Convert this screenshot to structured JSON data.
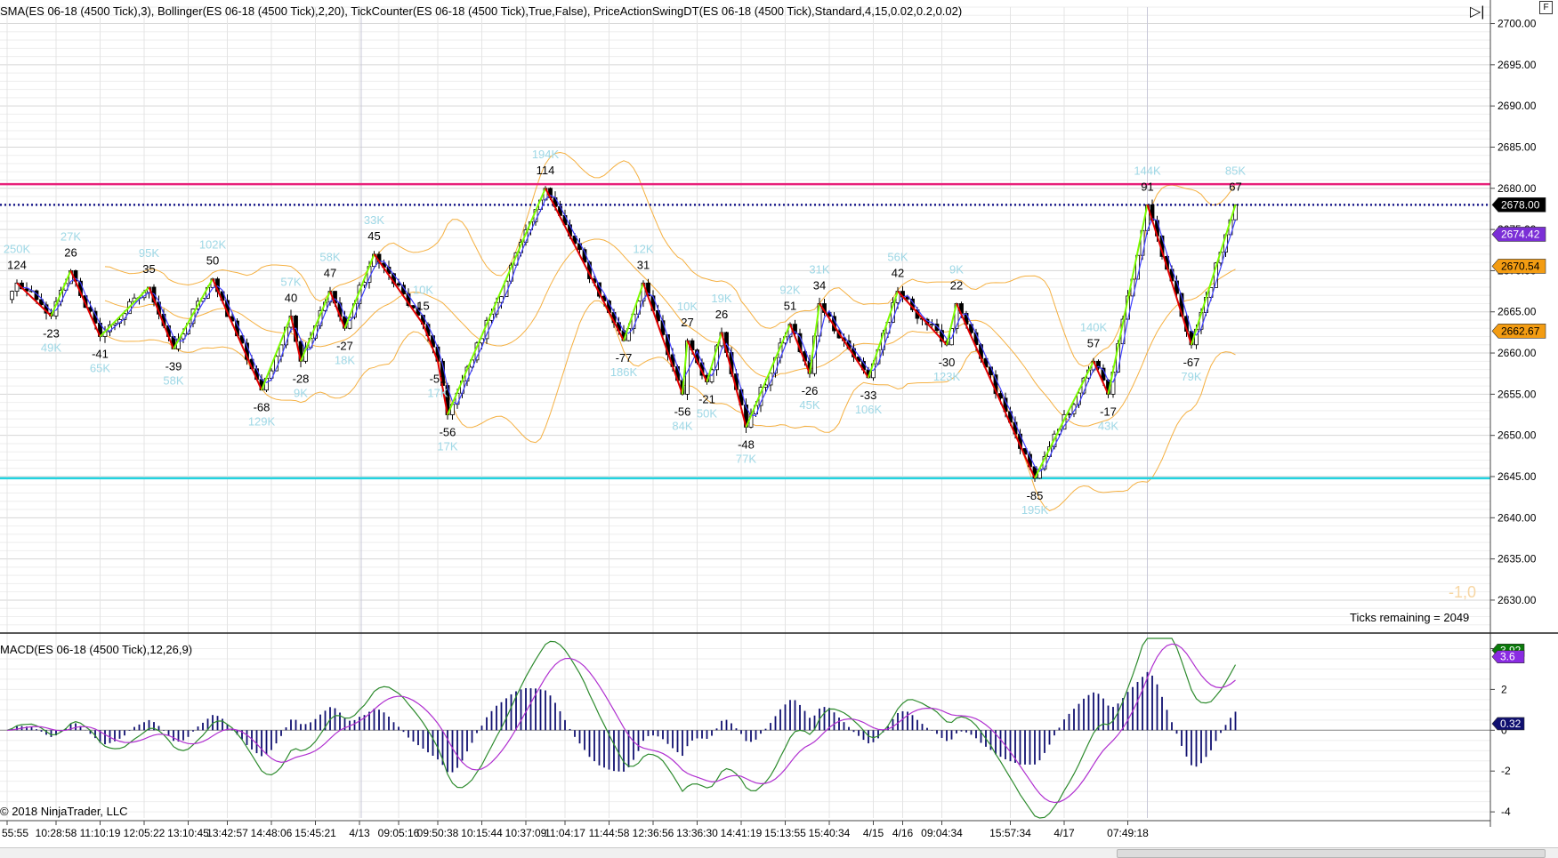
{
  "window": {
    "corner_button": "F"
  },
  "price_panel": {
    "indicator_label": "SMA(ES  06-18  (4500  Tick),3),   Bollinger(ES  06-18  (4500  Tick),2,20),   TickCounter(ES  06-18  (4500  Tick),True,False),   PriceActionSwingDT(ES  06-18  (4500  Tick),Standard,4,15,0.02,0.2,0.02)",
    "ticks_remaining": "Ticks remaining = 2049",
    "faint_value": "-1,0"
  },
  "macd_panel": {
    "indicator_label": "MACD(ES 06-18 (4500 Tick),12,26,9)",
    "copyright": "© 2018 NinjaTrader, LLC"
  },
  "chart_data": {
    "type": "candlestick",
    "price_axis": {
      "ylim": [
        2626,
        2702
      ],
      "ticks": [
        "2700.00",
        "2695.00",
        "2690.00",
        "2685.00",
        "2680.00",
        "2675.00",
        "2670.00",
        "2665.00",
        "2660.00",
        "2655.00",
        "2650.00",
        "2645.00",
        "2640.00",
        "2635.00",
        "2630.00"
      ],
      "tick_values": [
        2700,
        2695,
        2690,
        2685,
        2680,
        2675,
        2670,
        2665,
        2660,
        2655,
        2650,
        2645,
        2640,
        2635,
        2630
      ]
    },
    "macd_axis": {
      "ylim": [
        -4.3,
        4.5
      ],
      "ticks": [
        "4",
        "2",
        "0",
        "-2",
        "-4"
      ],
      "tick_values": [
        4,
        2,
        0,
        -2,
        -4
      ]
    },
    "time_axis": {
      "bars": 241,
      "labels": [
        "55:55",
        "10:28:58",
        "11:10:19",
        "12:05:22",
        "13:10:45",
        "13:42:57",
        "14:48:06",
        "15:45:21",
        "4/13",
        "09:05:16",
        "09:50:38",
        "10:15:44",
        "10:37:09",
        "11:04:17",
        "11:44:58",
        "12:36:56",
        "13:36:30",
        "14:41:19",
        "15:13:55",
        "15:40:34",
        "4/15",
        "4/16",
        "09:04:34",
        "15:57:34",
        "4/17",
        "07:49:18"
      ],
      "label_bars": [
        0,
        10,
        19,
        28,
        37,
        45,
        54,
        63,
        72,
        80,
        88,
        97,
        106,
        114,
        123,
        132,
        141,
        150,
        159,
        168,
        177,
        183,
        191,
        205,
        216,
        229
      ]
    },
    "horizontal_lines": [
      {
        "name": "resistance",
        "value": 2680.5,
        "color": "#e8217a",
        "style": "solid"
      },
      {
        "name": "current",
        "value": 2678.0,
        "color": "#1a1a8c",
        "style": "dotted"
      },
      {
        "name": "support",
        "value": 2644.8,
        "color": "#22d3e0",
        "style": "solid"
      }
    ],
    "price_flags": [
      {
        "value": 2678.0,
        "label": "2678.00",
        "bg": "#000000",
        "fg": "#ffffff"
      },
      {
        "value": 2674.42,
        "label": "2674.42",
        "bg": "#7b2fd6",
        "fg": "#ffffff"
      },
      {
        "value": 2670.54,
        "label": "2670.54",
        "bg": "#f39c12",
        "fg": "#000000"
      },
      {
        "value": 2662.67,
        "label": "2662.67",
        "bg": "#f39c12",
        "fg": "#000000"
      }
    ],
    "macd_flags": [
      {
        "value": 3.92,
        "label": "3.92",
        "bg": "#0a7a0a",
        "fg": "#ffffff"
      },
      {
        "value": 3.6,
        "label": "3.6",
        "bg": "#8a2be2",
        "fg": "#ffffff"
      },
      {
        "value": 0.32,
        "label": "0.32",
        "bg": "#101070",
        "fg": "#ffffff"
      }
    ],
    "swings": [
      {
        "bar": 2,
        "price": 2668.5,
        "label": "124",
        "vol": "250K",
        "type": "high"
      },
      {
        "bar": 9,
        "price": 2664.5,
        "label": "-23",
        "vol": "49K",
        "type": "low"
      },
      {
        "bar": 13,
        "price": 2670.0,
        "label": "26",
        "vol": "27K",
        "type": "high"
      },
      {
        "bar": 19,
        "price": 2662.0,
        "label": "-41",
        "vol": "65K",
        "type": "low"
      },
      {
        "bar": 29,
        "price": 2668.0,
        "label": "35",
        "vol": "95K",
        "type": "high"
      },
      {
        "bar": 34,
        "price": 2660.5,
        "label": "-39",
        "vol": "58K",
        "type": "low"
      },
      {
        "bar": 42,
        "price": 2669.0,
        "label": "50",
        "vol": "102K",
        "type": "high"
      },
      {
        "bar": 52,
        "price": 2655.5,
        "label": "-68",
        "vol": "129K",
        "type": "low"
      },
      {
        "bar": 58,
        "price": 2664.5,
        "label": "40",
        "vol": "57K",
        "type": "high"
      },
      {
        "bar": 60,
        "price": 2659.0,
        "label": "-28",
        "vol": "9K",
        "type": "low"
      },
      {
        "bar": 66,
        "price": 2667.5,
        "label": "47",
        "vol": "58K",
        "type": "high"
      },
      {
        "bar": 69,
        "price": 2663.0,
        "label": "-27",
        "vol": "18K",
        "type": "low"
      },
      {
        "bar": 75,
        "price": 2672.0,
        "label": "45",
        "vol": "33K",
        "type": "high"
      },
      {
        "bar": 85,
        "price": 2663.5,
        "label": "15",
        "vol": "10K",
        "type": "high"
      },
      {
        "bar": 88,
        "price": 2659.0,
        "label": "-51",
        "vol": "17K",
        "type": "low"
      },
      {
        "bar": 90,
        "price": 2652.5,
        "label": "-56",
        "vol": "17K",
        "type": "low"
      },
      {
        "bar": 110,
        "price": 2680.0,
        "label": "114",
        "vol": "194K",
        "type": "high"
      },
      {
        "bar": 126,
        "price": 2661.5,
        "label": "-77",
        "vol": "186K",
        "type": "low"
      },
      {
        "bar": 130,
        "price": 2668.5,
        "label": "31",
        "vol": "12K",
        "type": "high"
      },
      {
        "bar": 138,
        "price": 2655.0,
        "label": "-56",
        "vol": "84K",
        "type": "low"
      },
      {
        "bar": 139,
        "price": 2661.5,
        "label": "27",
        "vol": "10K",
        "type": "high"
      },
      {
        "bar": 143,
        "price": 2656.5,
        "label": "-21",
        "vol": "50K",
        "type": "low"
      },
      {
        "bar": 146,
        "price": 2662.5,
        "label": "26",
        "vol": "19K",
        "type": "high"
      },
      {
        "bar": 151,
        "price": 2651.0,
        "label": "-48",
        "vol": "77K",
        "type": "low"
      },
      {
        "bar": 160,
        "price": 2663.5,
        "label": "51",
        "vol": "92K",
        "type": "high"
      },
      {
        "bar": 164,
        "price": 2657.5,
        "label": "-26",
        "vol": "45K",
        "type": "low"
      },
      {
        "bar": 166,
        "price": 2666.0,
        "label": "34",
        "vol": "31K",
        "type": "high"
      },
      {
        "bar": 176,
        "price": 2657.0,
        "label": "-33",
        "vol": "106K",
        "type": "low"
      },
      {
        "bar": 182,
        "price": 2667.5,
        "label": "42",
        "vol": "56K",
        "type": "high"
      },
      {
        "bar": 192,
        "price": 2661.0,
        "label": "-30",
        "vol": "123K",
        "type": "low"
      },
      {
        "bar": 194,
        "price": 2666.0,
        "label": "22",
        "vol": "9K",
        "type": "high"
      },
      {
        "bar": 210,
        "price": 2644.8,
        "label": "-85",
        "vol": "195K",
        "type": "low"
      },
      {
        "bar": 222,
        "price": 2659.0,
        "label": "57",
        "vol": "140K",
        "type": "high"
      },
      {
        "bar": 225,
        "price": 2655.0,
        "label": "-17",
        "vol": "43K",
        "type": "low"
      },
      {
        "bar": 233,
        "price": 2678.0,
        "label": "91",
        "vol": "144K",
        "type": "high"
      },
      {
        "bar": 242,
        "price": 2661.0,
        "label": "-67",
        "vol": "79K",
        "type": "low"
      },
      {
        "bar": 251,
        "price": 2678.0,
        "label": "67",
        "vol": "85K",
        "type": "high"
      }
    ]
  }
}
